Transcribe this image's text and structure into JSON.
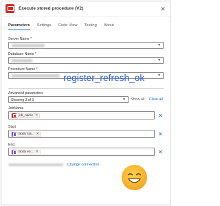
{
  "header": {
    "title": "Execute stored procedure (V2)",
    "icon": "sql-procedure-icon",
    "close_glyph": "✕"
  },
  "tabs": [
    {
      "label": "Parameters",
      "active": true
    },
    {
      "label": "Settings",
      "active": false
    },
    {
      "label": "Code View",
      "active": false
    },
    {
      "label": "Testing",
      "active": false
    },
    {
      "label": "About",
      "active": false
    }
  ],
  "fields": {
    "server_name": {
      "label": "Server Name *"
    },
    "database_name": {
      "label": "Database Name *"
    },
    "procedure_name": {
      "label": "Procedure Name *"
    }
  },
  "overlay": {
    "text": "register_refresh_ok"
  },
  "advanced": {
    "label": "Advanced parameters",
    "selected": "Showing 3 of 3",
    "show_all": "Show all",
    "clear_all": "Clear all"
  },
  "params": [
    {
      "label": "JobName",
      "token": "job_name",
      "icon": "sql-token-icon",
      "color": "#c8312c"
    },
    {
      "label": "Start",
      "token": "Body sta...",
      "icon": "variable-token-icon",
      "color": "#7a5bd3"
    },
    {
      "label": "End",
      "token": "Body en...",
      "icon": "variable-token-icon",
      "color": "#7a5bd3"
    }
  ],
  "connection": {
    "change_label": "Change connection"
  },
  "colors": {
    "accent": "#0f6cbd",
    "brand_red": "#c8312c",
    "token_purple": "#7a5bd3",
    "overlay_blue": "#2d5fe6"
  }
}
